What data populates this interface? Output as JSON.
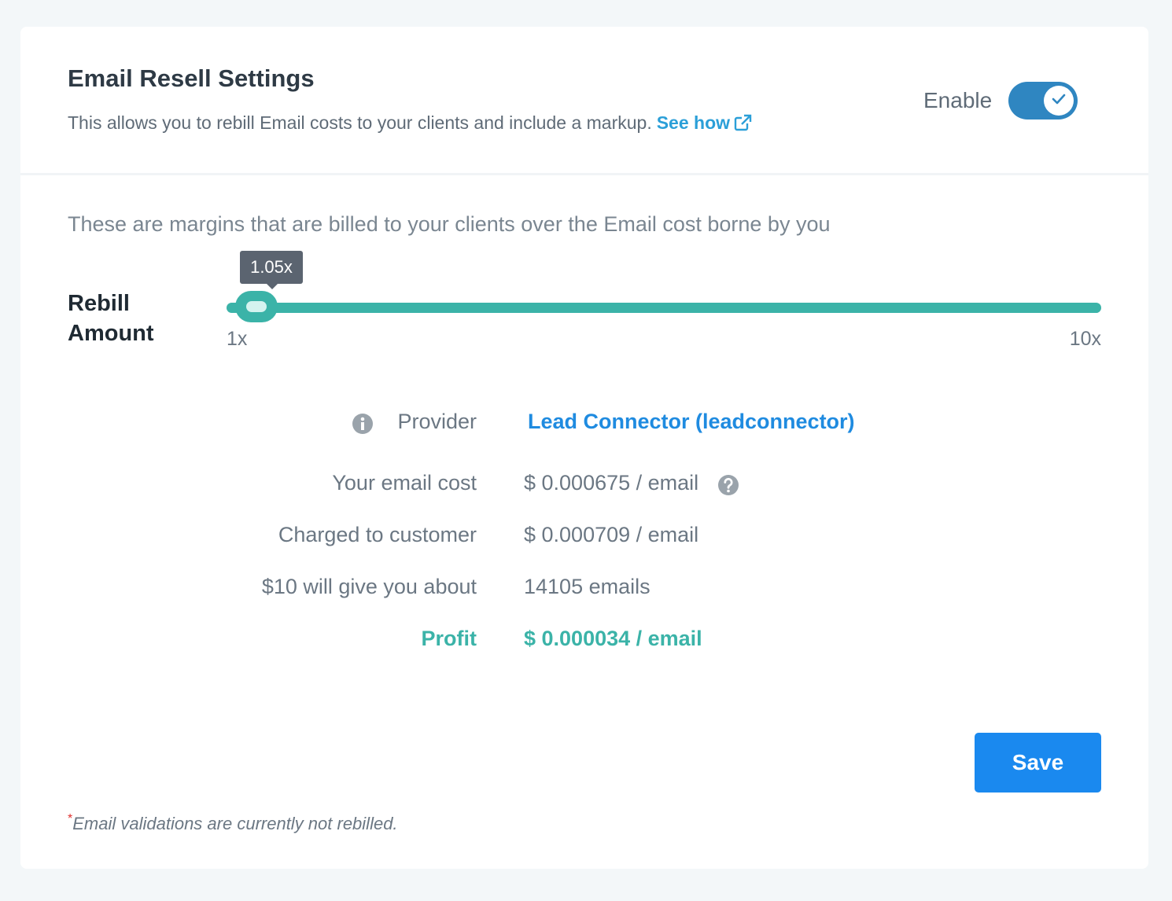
{
  "header": {
    "title": "Email Resell Settings",
    "subtitle": "This allows you to rebill Email costs to your clients and include a markup.",
    "see_how_label": "See how",
    "enable_label": "Enable",
    "enabled": true
  },
  "margins": {
    "description": "These are margins that are billed to your clients over the Email cost borne by you",
    "rebill_label": "Rebill Amount",
    "slider": {
      "value": 1.05,
      "min": 1,
      "max": 10,
      "value_label": "1.05x",
      "min_label": "1x",
      "max_label": "10x"
    }
  },
  "details": {
    "provider_label": "Provider",
    "provider_value": "Lead Connector (leadconnector)",
    "cost_label": "Your email cost",
    "cost_value": "$ 0.000675 / email",
    "charged_label": "Charged to customer",
    "charged_value": "$ 0.000709 / email",
    "estimate_label": "$10 will give you about",
    "estimate_value": "14105 emails",
    "profit_label": "Profit",
    "profit_value": "$ 0.000034 / email"
  },
  "actions": {
    "save_label": "Save"
  },
  "footnote": {
    "asterisk": "*",
    "text": "Email validations are currently not rebilled."
  },
  "colors": {
    "accent_teal": "#3bb3a8",
    "link_blue": "#1f8be0",
    "toggle_blue": "#2f86c1",
    "save_blue": "#1a89ef"
  }
}
